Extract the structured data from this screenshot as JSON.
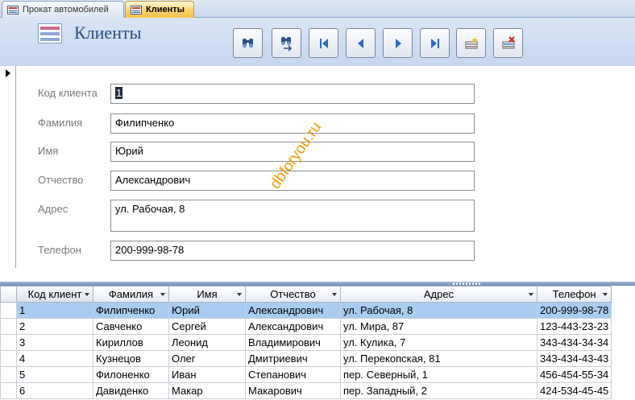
{
  "tabs": [
    {
      "label": "Прокат автомобилей",
      "active": false
    },
    {
      "label": "Клиенты",
      "active": true
    }
  ],
  "header": {
    "title": "Клиенты",
    "buttons": [
      {
        "name": "find-icon"
      },
      {
        "name": "find-next-icon"
      },
      {
        "name": "first-record-icon"
      },
      {
        "name": "previous-record-icon"
      },
      {
        "name": "next-record-icon"
      },
      {
        "name": "last-record-icon"
      },
      {
        "name": "new-record-icon"
      },
      {
        "name": "delete-record-icon"
      }
    ]
  },
  "form": {
    "fields": [
      {
        "label": "Код клиента",
        "value": "1"
      },
      {
        "label": "Фамилия",
        "value": "Филипченко"
      },
      {
        "label": "Имя",
        "value": "Юрий"
      },
      {
        "label": "Отчество",
        "value": "Александрович"
      },
      {
        "label": "Адрес",
        "value": "ул. Рабочая, 8"
      },
      {
        "label": "Телефон",
        "value": "200-999-98-78"
      }
    ]
  },
  "watermark": "dbforyou.ru",
  "table": {
    "columns": [
      "Код клиент",
      "Фамилия",
      "Имя",
      "Отчество",
      "Адрес",
      "Телефон"
    ],
    "rows": [
      [
        "1",
        "Филипченко",
        "Юрий",
        "Александрович",
        "ул. Рабочая, 8",
        "200-999-98-78"
      ],
      [
        "2",
        "Савченко",
        "Сергей",
        "Александрович",
        "ул. Мира, 87",
        "123-443-23-23"
      ],
      [
        "3",
        "Кириллов",
        "Леонид",
        "Владимирович",
        "ул. Кулика, 7",
        "343-434-34-34"
      ],
      [
        "4",
        "Кузнецов",
        "Олег",
        "Дмитриевич",
        "ул. Перекопская, 81",
        "343-434-43-43"
      ],
      [
        "5",
        "Филоненко",
        "Иван",
        "Степанович",
        "пер. Северный, 1",
        "456-454-55-34"
      ],
      [
        "6",
        "Давиденко",
        "Макар",
        "Макарович",
        "пер. Западный, 2",
        "424-534-45-45"
      ]
    ]
  },
  "colors": {
    "accent_tab": "#f6c24a",
    "selected_row": "#a9cdf1",
    "header_bg": "#c5d6ee",
    "title": "#2a4c85"
  }
}
